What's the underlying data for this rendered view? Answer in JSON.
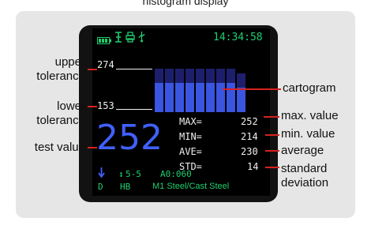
{
  "caption": "histogram display",
  "status": {
    "time": "14:34:58"
  },
  "histogram": {
    "upper_tolerance": "274",
    "lower_tolerance": "153",
    "bar_levels": [
      0.97,
      0.97,
      0.97,
      0.97,
      0.97,
      0.97,
      0.97,
      0.97,
      0.86
    ]
  },
  "test_value": "252",
  "stats": [
    {
      "label": "MAX=",
      "value": "252"
    },
    {
      "label": "MIN=",
      "value": "214"
    },
    {
      "label": "AVE=",
      "value": "230"
    },
    {
      "label": "STD=",
      "value": "14"
    }
  ],
  "footer": {
    "probe": "D",
    "scale": "HB",
    "direction": "↕",
    "mode": "5-5",
    "a0": "A0:060",
    "material": "M1 Steel/Cast Steel"
  },
  "annotations": {
    "upper_tolerance": [
      "upper",
      "tolerance"
    ],
    "lower_tolerance": [
      "lower",
      "tolerance"
    ],
    "test_value": "test value",
    "cartogram": "cartogram",
    "max_value": "max. value",
    "min_value": "min. value",
    "average": "average",
    "standard_deviation": [
      "standard",
      "deviation"
    ]
  },
  "colors": {
    "screen_green": "#1fcf6e",
    "screen_blue": "#4060ff",
    "leader_line": "#d6231e"
  }
}
